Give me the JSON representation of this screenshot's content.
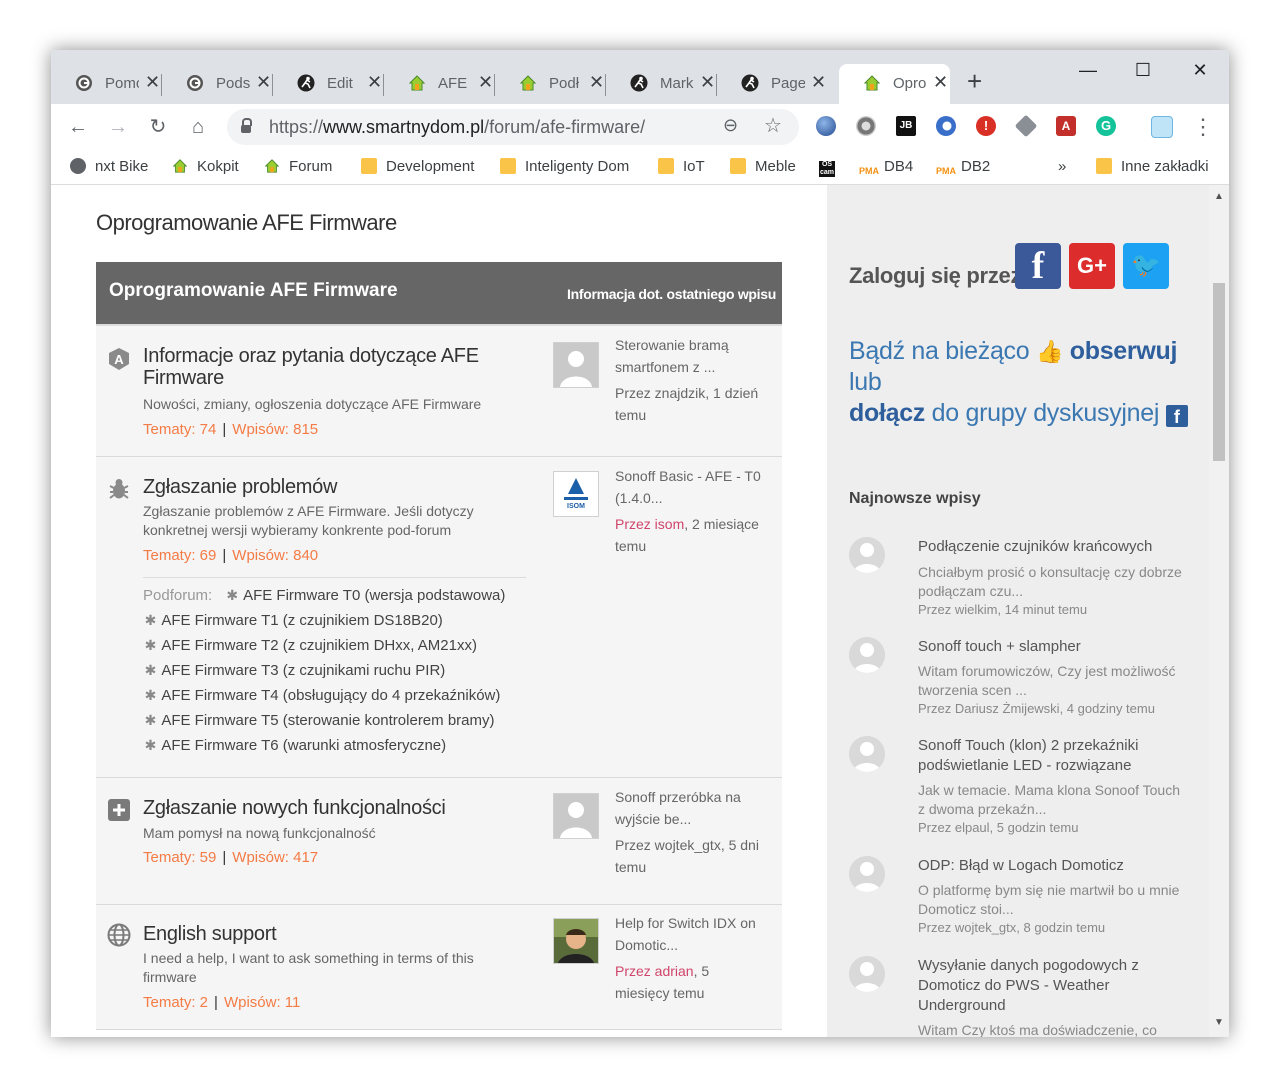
{
  "browser": {
    "tabs": [
      {
        "title": "Pomoc",
        "icon": "grammarly-icon",
        "active": false
      },
      {
        "title": "Podst",
        "icon": "grammarly-icon",
        "active": false
      },
      {
        "title": "Edit",
        "icon": "runner-icon",
        "active": false
      },
      {
        "title": "AFE F",
        "icon": "smart-home-icon",
        "active": false
      },
      {
        "title": "Podł",
        "icon": "smart-home-icon",
        "active": false
      },
      {
        "title": "Mark",
        "icon": "runner-icon",
        "active": false
      },
      {
        "title": "Page",
        "icon": "runner-icon",
        "active": false
      },
      {
        "title": "Oprogr",
        "icon": "smart-home-icon",
        "active": true
      }
    ],
    "url_scheme": "https://",
    "url_host": "www.smartnydom.pl",
    "url_path": "/forum/afe-firmware/",
    "bookmarks": [
      {
        "label": "nxt Bike",
        "icon": "globe-icon"
      },
      {
        "label": "Kokpit",
        "icon": "smart-home-icon"
      },
      {
        "label": "Forum",
        "icon": "smart-home-icon"
      },
      {
        "label": "Development",
        "icon": "folder-icon"
      },
      {
        "label": "Inteligenty Dom",
        "icon": "folder-icon"
      },
      {
        "label": "IoT",
        "icon": "folder-icon"
      },
      {
        "label": "Meble",
        "icon": "folder-icon"
      },
      {
        "label": "",
        "icon": "oscam-icon"
      },
      {
        "label": "DB4",
        "icon": "phpmyadmin-icon"
      },
      {
        "label": "DB2",
        "icon": "phpmyadmin-icon"
      }
    ],
    "more_bookmarks": "»",
    "other_bookmarks": "Inne zakładki"
  },
  "page": {
    "heading": "Oprogramowanie AFE Firmware",
    "table_header": {
      "title": "Oprogramowanie AFE Firmware",
      "last_post_label": "Informacja dot. ostatniego wpisu"
    },
    "forums": [
      {
        "icon": "shield-a-icon",
        "title": "Informacje oraz pytania dotyczące AFE Firmware",
        "description": "Nowości, zmiany, ogłoszenia dotyczące AFE Firmware",
        "topics": "Tematy: 74",
        "posts": "Wpisów: 815",
        "last_post": {
          "title": "Sterowanie bramą smartfonem z ...",
          "by": "Przez znajdzik, 1 dzień temu"
        }
      },
      {
        "icon": "bug-icon",
        "title": "Zgłaszanie problemów",
        "description": "Zgłaszanie problemów z AFE Firmware. Jeśli dotyczy konkretnej wersji wybieramy konkrente pod-forum",
        "topics": "Tematy: 69",
        "posts": "Wpisów: 840",
        "subforums_label": "Podforum:",
        "subforums": [
          "AFE Firmware T0 (wersja podstawowa)",
          "AFE Firmware T1 (z czujnikiem DS18B20)",
          "AFE Firmware T2 (z czujnikiem DHxx, AM21xx)",
          "AFE Firmware T3 (z czujnikami ruchu PIR)",
          "AFE Firmware T4 (obsługujący do 4 przekaźników)",
          "AFE Firmware T5 (sterowanie kontrolerem bramy)",
          "AFE Firmware T6 (warunki atmosferyczne)"
        ],
        "last_post": {
          "title": "Sonoff Basic - AFE - T0 (1.4.0...",
          "by_prefix": "Przez isom",
          "by_suffix": ", 2 miesiące temu"
        }
      },
      {
        "icon": "plus-square-icon",
        "title": "Zgłaszanie nowych funkcjonalności",
        "description": "Mam pomysł na nową funkcjonalność",
        "topics": "Tematy: 59",
        "posts": "Wpisów: 417",
        "last_post": {
          "title": "Sonoff przeróbka na wyjście be...",
          "by": "Przez wojtek_gtx, 5 dni temu"
        }
      },
      {
        "icon": "globe-icon",
        "title": "English support",
        "description": "I need a help, I want to ask something in terms of this firmware",
        "topics": "Tematy: 2",
        "posts": "Wpisów: 11",
        "last_post": {
          "title": "Help for Switch IDX on Domotic...",
          "by_prefix": "Przez adrian",
          "by_suffix": ", 5 miesięcy temu"
        }
      }
    ],
    "stats_separator": "|"
  },
  "sidebar": {
    "login_label": "Zaloguj się przez",
    "social": [
      {
        "icon": "facebook-icon",
        "glyph": "f",
        "color": "#3b5998"
      },
      {
        "icon": "google-plus-icon",
        "glyph": "G+",
        "color": "#dd2c2c"
      },
      {
        "icon": "twitter-icon",
        "glyph": "🐦",
        "color": "#1da1f2"
      }
    ],
    "follow_prefix": "Bądź na bieżąco",
    "follow_link": "obserwuj",
    "follow_mid": "lub",
    "join_link": "dołącz",
    "join_suffix": "do grupy dyskusyjnej",
    "newest_title": "Najnowsze wpisy",
    "newest": [
      {
        "title": "Podłączenie czujników krańcowych",
        "excerpt": "Chciałbym prosić o konsultację czy dobrze podłączam czu...",
        "meta": "Przez wielkim, 14 minut temu"
      },
      {
        "title": "Sonoff touch + slampher",
        "excerpt": "Witam forumowiczów,  Czy jest możliwość tworzenia scen ...",
        "meta": "Przez Dariusz Żmijewski, 4 godziny temu"
      },
      {
        "title": "Sonoff Touch (klon) 2 przekaźniki podświetlanie LED - rozwiązane",
        "excerpt": "Jak w temacie. Mama klona Sonoof Touch z dwoma przekaźn...",
        "meta": "Przez elpaul, 5 godzin temu"
      },
      {
        "title": "ODP: Błąd w Logach Domoticz",
        "excerpt": "O platformę bym się nie martwił bo u mnie Domoticz stoi...",
        "meta": "Przez wojtek_gtx, 8 godzin temu"
      },
      {
        "title": "Wysyłanie danych pogodowych z Domoticz do PWS - Weather Underground",
        "excerpt": "Witam Czy ktoś ma doświadczenie, co",
        "meta": ""
      }
    ]
  }
}
